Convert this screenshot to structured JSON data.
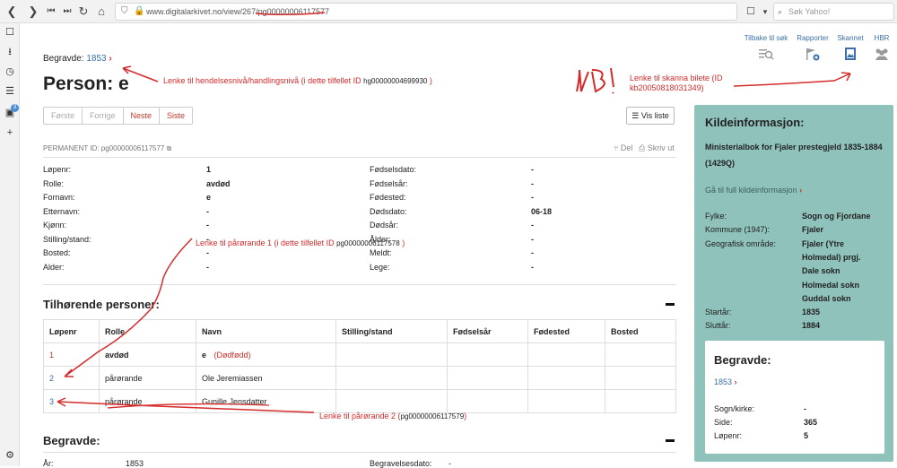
{
  "browser": {
    "url_host": "www.digitalarkivet.no",
    "url_path": "/view/267/pg00000006117577",
    "search_placeholder": "Søk Yahoo!"
  },
  "sidebar": {
    "badge_count": "3"
  },
  "header": {
    "begravde_label": "Begravde:",
    "begravde_year": "1853",
    "title": "Person: e"
  },
  "tools": [
    {
      "label": "Tilbake til søk",
      "icon": "search-list-icon"
    },
    {
      "label": "Rapporter",
      "icon": "flag-plus-icon"
    },
    {
      "label": "Skannet",
      "icon": "image-icon"
    },
    {
      "label": "HBR",
      "icon": "people-icon"
    }
  ],
  "pager": {
    "first": "Første",
    "prev": "Forrige",
    "next": "Neste",
    "last": "Siste"
  },
  "vis_liste": "Vis liste",
  "permanent_id": {
    "label": "PERMANENT ID:",
    "value": "pg00000006117577"
  },
  "actions": {
    "share": "Del",
    "print": "Skriv ut"
  },
  "person_left": [
    {
      "k": "Løpenr:",
      "v": "1"
    },
    {
      "k": "Rolle:",
      "v": "avdød"
    },
    {
      "k": "Fornavn:",
      "v": "e"
    },
    {
      "k": "Etternavn:",
      "v": "-"
    },
    {
      "k": "Kjønn:",
      "v": "-"
    },
    {
      "k": "Stilling/stand:",
      "v": "-"
    },
    {
      "k": "Bosted:",
      "v": "-"
    },
    {
      "k": "Alder:",
      "v": "-"
    }
  ],
  "person_right": [
    {
      "k": "Fødselsdato:",
      "v": "-"
    },
    {
      "k": "Fødselsår:",
      "v": "-"
    },
    {
      "k": "Fødested:",
      "v": "-"
    },
    {
      "k": "Dødsdato:",
      "v": "06-18"
    },
    {
      "k": "Dødsår:",
      "v": "-"
    },
    {
      "k": "Ålder:",
      "v": "-"
    },
    {
      "k": "Meldt:",
      "v": "-"
    },
    {
      "k": "Lege:",
      "v": "-"
    }
  ],
  "tilhorende": {
    "heading": "Tilhørende personer:",
    "columns": [
      "Løpenr",
      "Rolle",
      "Navn",
      "Stilling/stand",
      "Fødselsår",
      "Fødested",
      "Bosted"
    ],
    "rows": [
      {
        "nr": "1",
        "rolle": "avdød",
        "navn": "e",
        "note": "(Dødfødd)"
      },
      {
        "nr": "2",
        "rolle": "pårørande",
        "navn": "Ole Jeremiassen",
        "note": ""
      },
      {
        "nr": "3",
        "rolle": "pårørande",
        "navn": "Gunille Jensdatter",
        "note": ""
      }
    ]
  },
  "begravde_section": {
    "heading": "Begravde:",
    "ar_label": "År:",
    "ar_value": "1853",
    "dato_label": "Begravelsesdato:",
    "dato_value": "-"
  },
  "kilde": {
    "heading": "Kildeinformasjon:",
    "source": "Ministerialbok for Fjaler prestegjeld 1835-1884 (1429Q)",
    "full_link": "Gå til full kildeinformasjon",
    "fields": [
      {
        "k": "Fylke:",
        "v": [
          "Sogn og Fjordane"
        ]
      },
      {
        "k": "Kommune (1947):",
        "v": [
          "Fjaler"
        ]
      },
      {
        "k": "Geografisk område:",
        "v": [
          "Fjaler (Ytre",
          "Holmedal) prgj.",
          "Dale sokn",
          "Holmedal sokn",
          "Guddal sokn"
        ]
      },
      {
        "k": "Startår:",
        "v": [
          "1835"
        ]
      },
      {
        "k": "Sluttår:",
        "v": [
          "1884"
        ]
      }
    ]
  },
  "begravde_box": {
    "heading": "Begravde:",
    "year": "1853",
    "fields": [
      {
        "k": "Sogn/kirke:",
        "v": "-"
      },
      {
        "k": "Side:",
        "v": "365"
      },
      {
        "k": "Løpenr:",
        "v": "5"
      }
    ]
  },
  "annotations": {
    "a1": "Lenke til hendelsesnivå/handlingsnivå (i dette tilfellet ID",
    "a1_id": "hg00000004699930",
    "a1_end": ")",
    "nb": "NB!",
    "a2": "Lenke til skanna bilete (ID",
    "a2b": "kb20050818031349)",
    "a3": "Lenke til pårørande 1 (i dette tilfellet ID",
    "a3_id": "pg00000006117578",
    "a3_end": ")",
    "a4": "Lenke til pårørande 2 (",
    "a4_id": "pg00000006117579",
    "a4_end": ")"
  },
  "colors": {
    "panel": "#8fc2bb",
    "link": "#3a6fa8",
    "red": "#c0392b",
    "annotation": "#d42a2a"
  }
}
